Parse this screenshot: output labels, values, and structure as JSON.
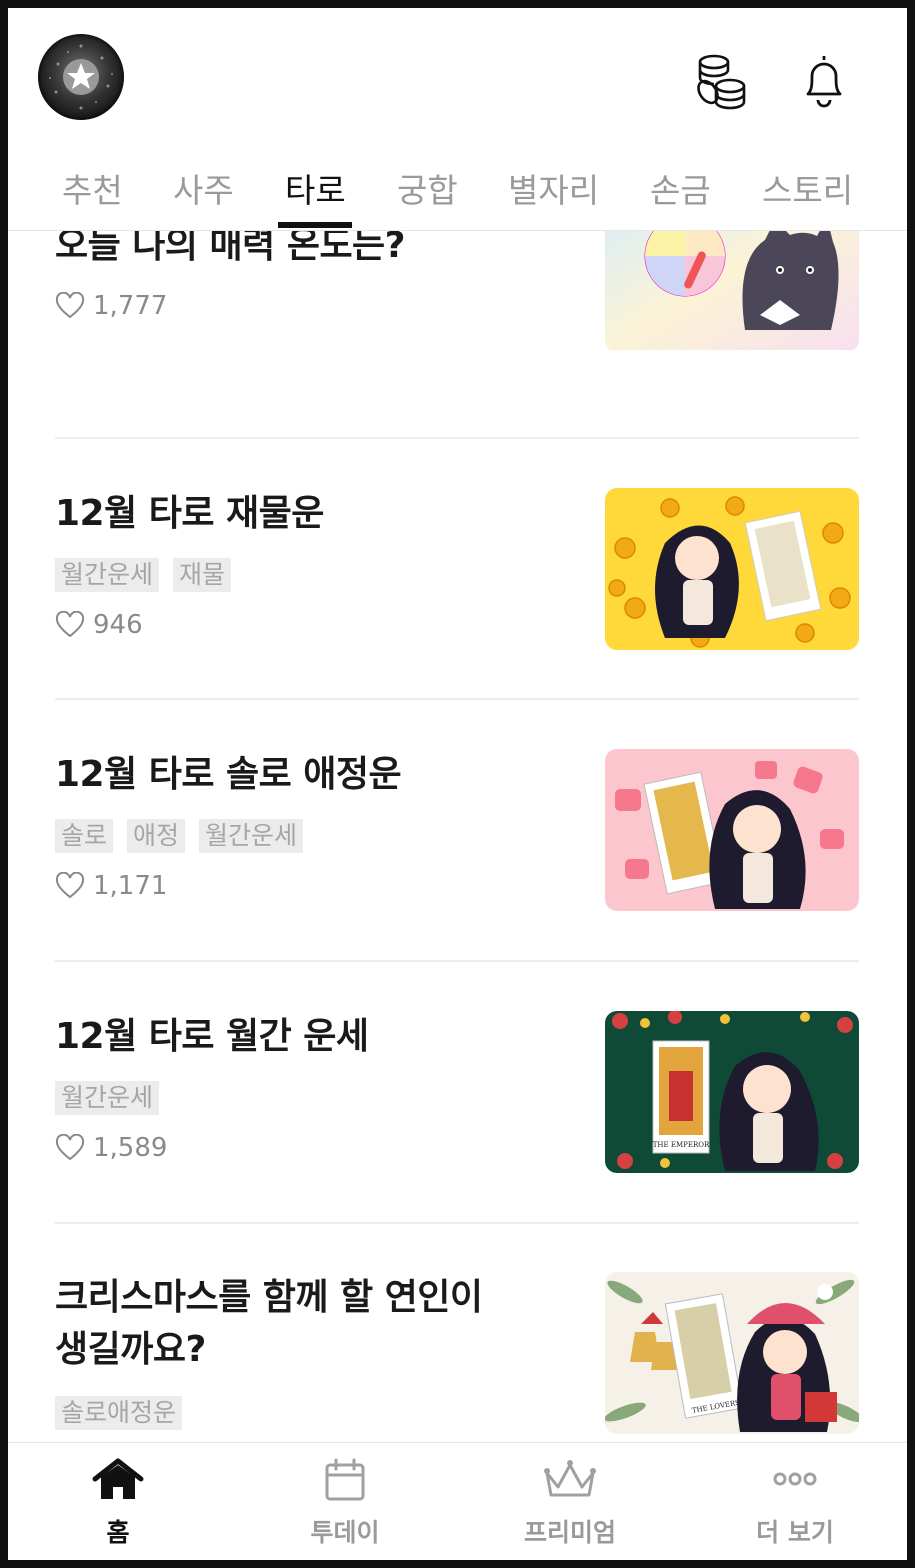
{
  "tabs": [
    "추천",
    "사주",
    "타로",
    "궁합",
    "별자리",
    "손금",
    "스토리"
  ],
  "active_tab": "타로",
  "items": [
    {
      "title": "오늘 나의 매력 온도는?",
      "tags": [],
      "likes": "1,777"
    },
    {
      "title": "12월 타로 재물운",
      "tags": [
        "월간운세",
        "재물"
      ],
      "likes": "946"
    },
    {
      "title": "12월 타로 솔로 애정운",
      "tags": [
        "솔로",
        "애정",
        "월간운세"
      ],
      "likes": "1,171"
    },
    {
      "title": "12월 타로 월간 운세",
      "tags": [
        "월간운세"
      ],
      "likes": "1,589"
    },
    {
      "title_line1": "크리스마스를 함께 할 연인이",
      "title_line2": "생길까요?",
      "tags": [
        "솔로애정운"
      ]
    }
  ],
  "thumb_texts": {
    "emperor": "THE EMPEROR",
    "lovers": "THE LOVERS"
  },
  "nav": [
    {
      "label": "홈",
      "icon": "home-icon",
      "active": true
    },
    {
      "label": "투데이",
      "icon": "calendar-icon",
      "active": false
    },
    {
      "label": "프리미엄",
      "icon": "crown-icon",
      "active": false
    },
    {
      "label": "더 보기",
      "icon": "more-dots-icon",
      "active": false
    }
  ],
  "colors": {
    "accent": "#111111",
    "tag_bg": "#ececec",
    "muted": "#9a9a9a"
  }
}
